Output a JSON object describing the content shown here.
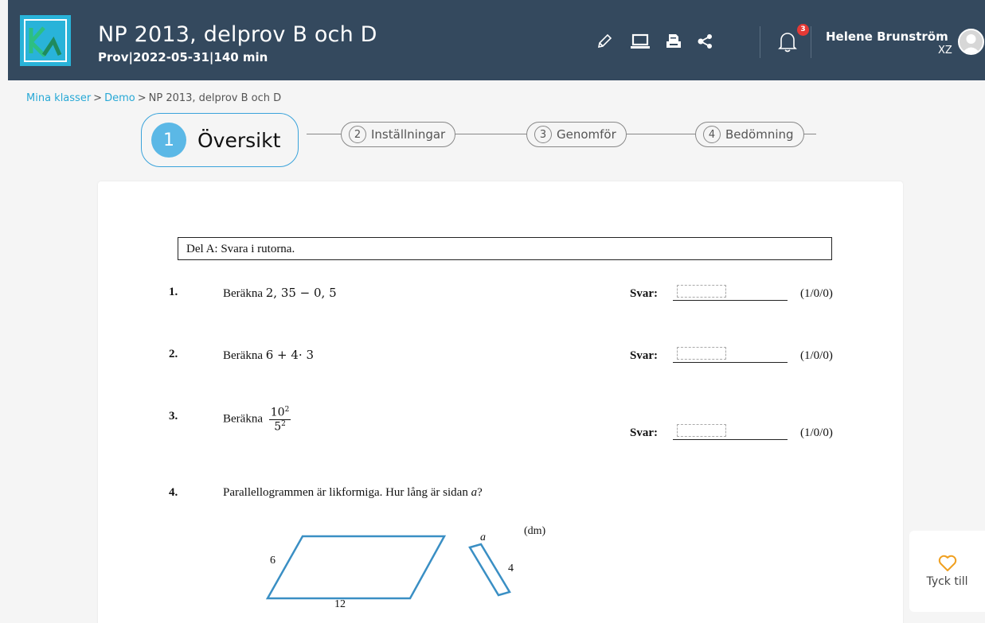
{
  "header": {
    "title": "NP 2013, delprov B och D",
    "subtitle": "Prov|2022-05-31|140 min",
    "notification_count": "3",
    "user_name": "Helene Brunström",
    "user_initials": "XZ"
  },
  "breadcrumb": {
    "items": [
      "Mina klasser",
      "Demo",
      "NP 2013, delprov B och D"
    ],
    "separator": ">"
  },
  "steps": [
    {
      "num": "1",
      "label": "Översikt",
      "active": true
    },
    {
      "num": "2",
      "label": "Inställningar",
      "active": false
    },
    {
      "num": "3",
      "label": "Genomför",
      "active": false
    },
    {
      "num": "4",
      "label": "Bedömning",
      "active": false
    }
  ],
  "document": {
    "section_title": "Del A: Svara i rutorna.",
    "answer_label": "Svar:",
    "questions": [
      {
        "num": "1.",
        "prefix": "Beräkna",
        "math": "2, 35 − 0, 5",
        "points": "(1/0/0)"
      },
      {
        "num": "2.",
        "prefix": "Beräkna",
        "math": "6 + 4· 3",
        "points": "(1/0/0)"
      },
      {
        "num": "3.",
        "prefix": "Beräkna",
        "numerator": "10",
        "numerator_exp": "2",
        "denominator": "5",
        "denominator_exp": "2",
        "points": "(1/0/0)"
      },
      {
        "num": "4.",
        "text": "Parallellogrammen är likformiga. Hur lång är sidan ",
        "var": "a",
        "end": "?"
      }
    ],
    "figure": {
      "unit": "(dm)",
      "big_side": "6",
      "big_base": "12",
      "small_top": "a",
      "small_side": "4"
    }
  },
  "feedback": {
    "label": "Tyck till"
  },
  "colors": {
    "header_bg": "#34495e",
    "accent": "#28a9d6",
    "badge": "#e53935",
    "figure_stroke": "#3a8fc4"
  }
}
